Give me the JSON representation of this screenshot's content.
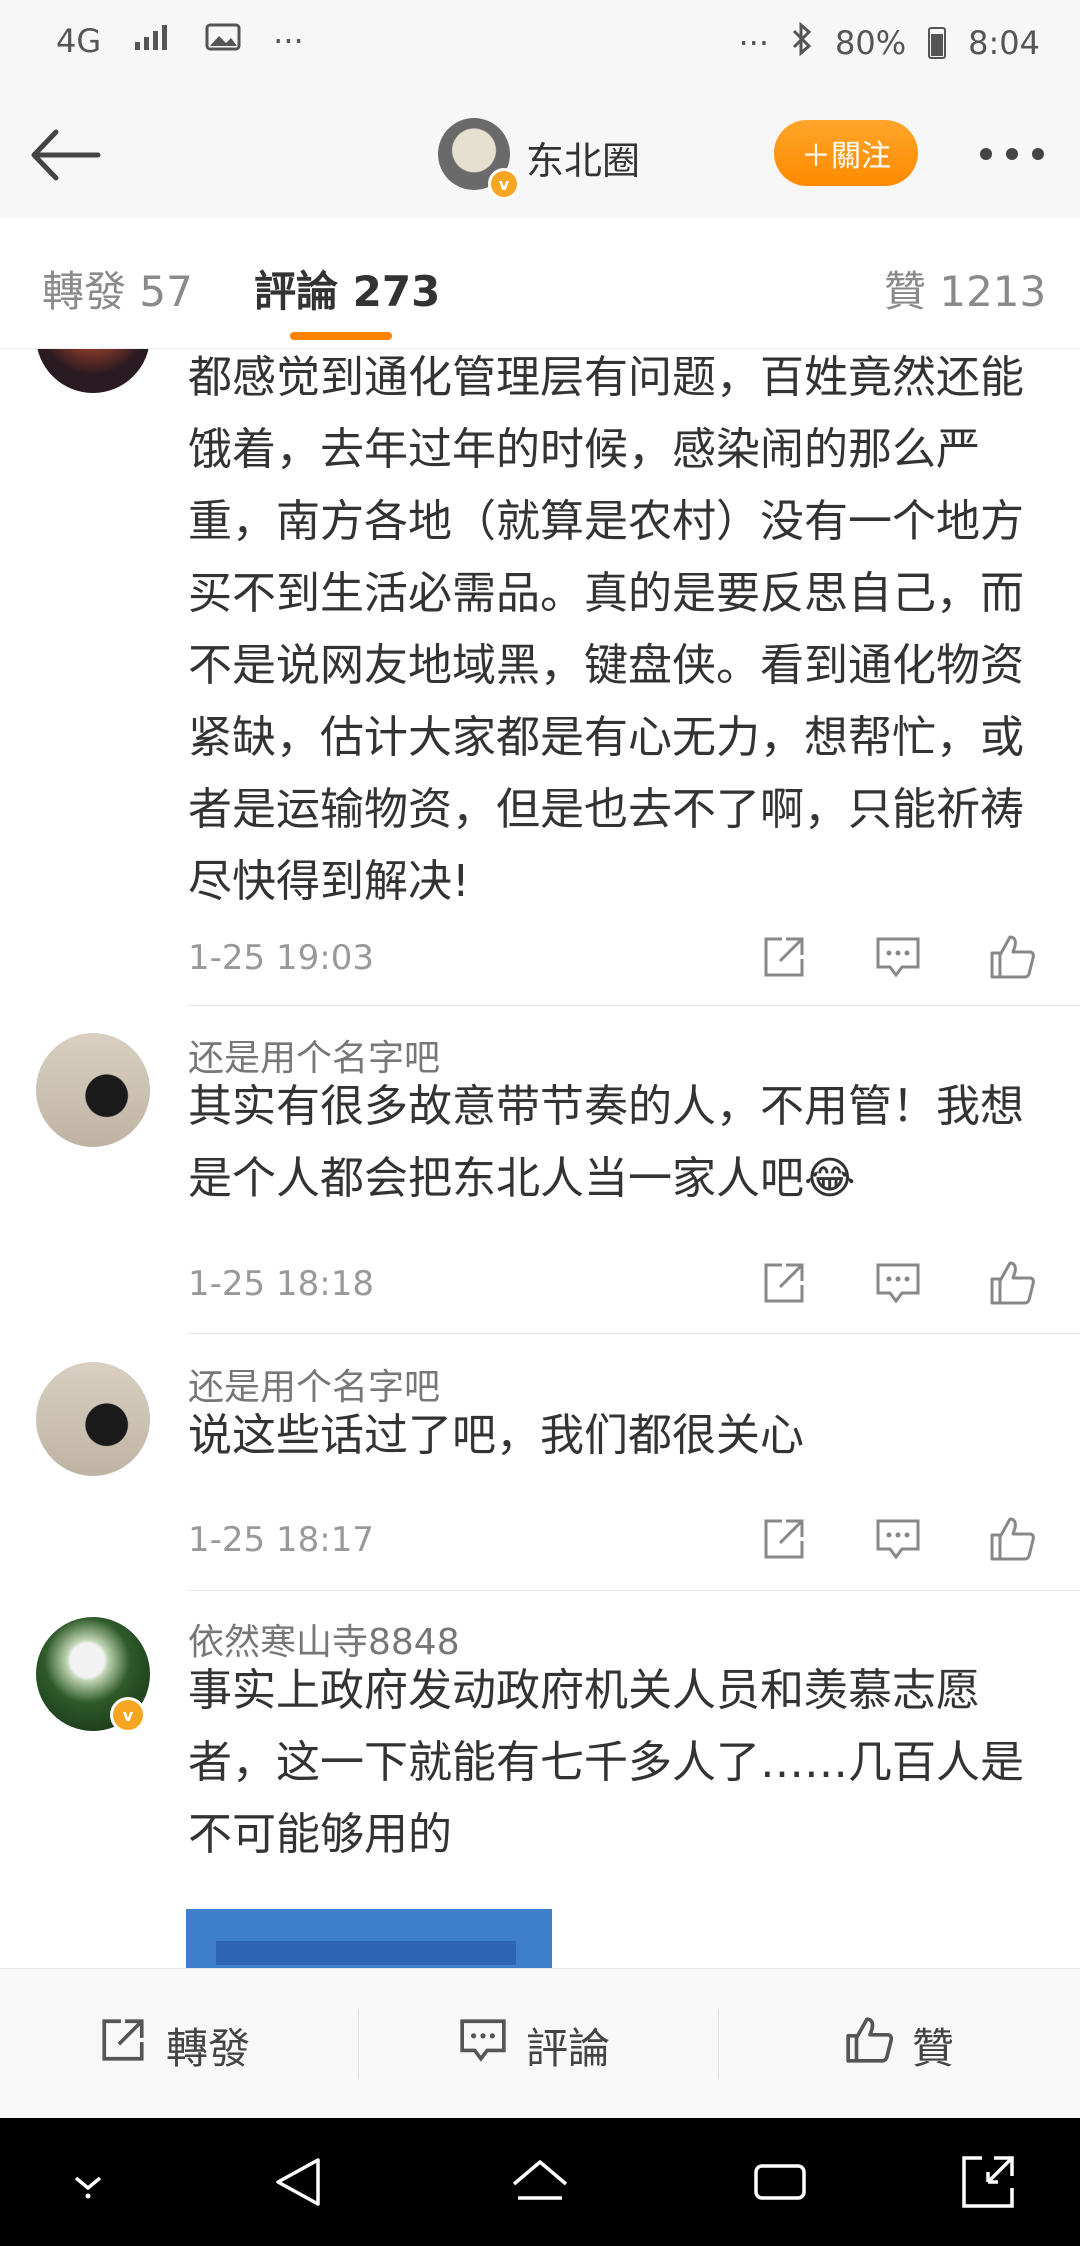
{
  "status_bar": {
    "network": "4G",
    "left_extra": "···",
    "right_extra": "···",
    "battery": "80%",
    "time": "8:04"
  },
  "header": {
    "title": "东北圈",
    "follow_label": "＋關注"
  },
  "tabs": [
    {
      "label": "轉發 57"
    },
    {
      "label": "評論 273"
    },
    {
      "label": "贊 1213"
    }
  ],
  "comments": [
    {
      "name": "",
      "text": "都感觉到通化管理层有问题，百姓竟然还能饿着，去年过年的时候，感染闹的那么严重，南方各地（就算是农村）没有一个地方买不到生活必需品。真的是要反思自己，而不是说网友地域黑，键盘侠。看到通化物资紧缺，估计大家都是有心无力，想帮忙，或者是运输物资，但是也去不了啊，只能祈祷尽快得到解决!",
      "time": "1-25 19:03"
    },
    {
      "name": "还是用个名字吧",
      "text": "其实有很多故意带节奏的人，不用管！我想是个人都会把东北人当一家人吧😂",
      "time": "1-25 18:18"
    },
    {
      "name": "还是用个名字吧",
      "text": "说这些话过了吧，我们都很关心",
      "time": "1-25 18:17"
    },
    {
      "name": "依然寒山寺8848",
      "text": "事实上政府发动政府机关人员和羡慕志愿者，这一下就能有七千多人了……几百人是不可能够用的",
      "time": ""
    }
  ],
  "bottom_bar": {
    "repost": "轉發",
    "comment": "評論",
    "like": "贊"
  },
  "colors": {
    "accent": "#ff8200",
    "follow_bg": "#ff9a1a",
    "verified_badge": "#f6a623"
  }
}
